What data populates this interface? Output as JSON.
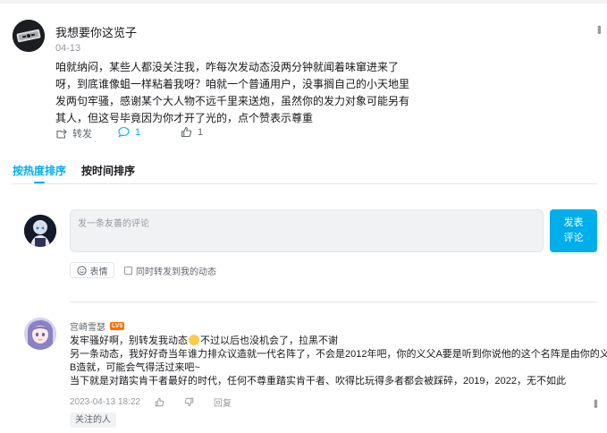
{
  "post": {
    "author": "我想要你这览子",
    "date": "04-13",
    "text": "咱就纳闷，某些人都没关注我，咋每次发动态没两分钟就闻着味窜进来了呀，到底谁像蛆一样粘着我呀？咱就一个普通用户，没事搁自己的小天地里发两句牢骚，感谢某个大人物不远千里来送炮，虽然你的发力对象可能另有其人，但这号毕竟因为你才开了光的，点个赞表示尊重",
    "actions": {
      "forward_label": "转发",
      "comment_count": "1",
      "like_count": "1"
    }
  },
  "tabs": [
    {
      "label": "按热度排序",
      "active": true
    },
    {
      "label": "按时间排序",
      "active": false
    }
  ],
  "composer": {
    "placeholder": "发一条友善的评论",
    "send_line1": "发表",
    "send_line2": "评论",
    "emoji_label": "表情",
    "forward_label": "同时转发到我的动态"
  },
  "comment": {
    "author": "宫崎雪瑟",
    "level": "LV5",
    "line1_a": "发牢骚好啊，别转发我动态",
    "line1_b": "不过以后也没机会了，拉黑不谢",
    "line2": "另一条动态，我好好奇当年谁力排众议造就一代名阵了，不会是2012年吧，你的义父A要是听到你说他的这个名阵是由你的义父",
    "line3": "B造就，可能会气得活过来吧~",
    "line4": "当下就是对踏实肯干者最好的时代，任何不尊重踏实肯干者、吹得比玩得多者都会被踩碎，2019，2022，无不如此",
    "time": "2023-04-13 18:22",
    "reply_label": "回复",
    "tag": "关注的人"
  },
  "colors": {
    "accent": "#00aeec",
    "text_primary": "#18191c",
    "text_secondary": "#61666d",
    "text_muted": "#9499a0",
    "level_badge": "#ff6c00"
  }
}
